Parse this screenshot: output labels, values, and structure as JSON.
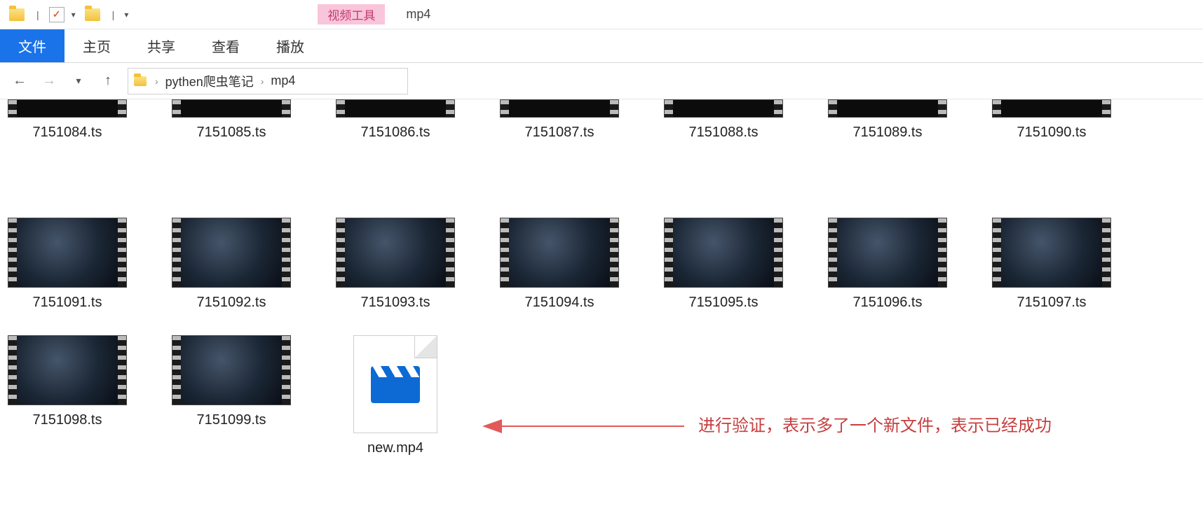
{
  "titlebar": {
    "tool_context_label": "视频工具",
    "window_title": "mp4",
    "check_glyph": "✓",
    "pipe": "|",
    "down": "▾"
  },
  "ribbon": {
    "file": "文件",
    "home": "主页",
    "share": "共享",
    "view": "查看",
    "play": "播放"
  },
  "nav": {
    "back": "←",
    "forward": "→",
    "dropdown": "▾",
    "up": "↑",
    "crumb1": "pythen爬虫笔记",
    "crumb2": "mp4",
    "sep": "›"
  },
  "files_row1": [
    {
      "name": "7151084.ts"
    },
    {
      "name": "7151085.ts"
    },
    {
      "name": "7151086.ts"
    },
    {
      "name": "7151087.ts"
    },
    {
      "name": "7151088.ts"
    },
    {
      "name": "7151089.ts"
    },
    {
      "name": "7151090.ts"
    }
  ],
  "files_row2": [
    {
      "name": "7151091.ts"
    },
    {
      "name": "7151092.ts"
    },
    {
      "name": "7151093.ts"
    },
    {
      "name": "7151094.ts"
    },
    {
      "name": "7151095.ts"
    },
    {
      "name": "7151096.ts"
    },
    {
      "name": "7151097.ts"
    }
  ],
  "files_row3": [
    {
      "name": "7151098.ts",
      "type": "ts"
    },
    {
      "name": "7151099.ts",
      "type": "ts"
    },
    {
      "name": "new.mp4",
      "type": "mp4"
    }
  ],
  "annotation": {
    "text": "进行验证，表示多了一个新文件，表示已经成功"
  }
}
